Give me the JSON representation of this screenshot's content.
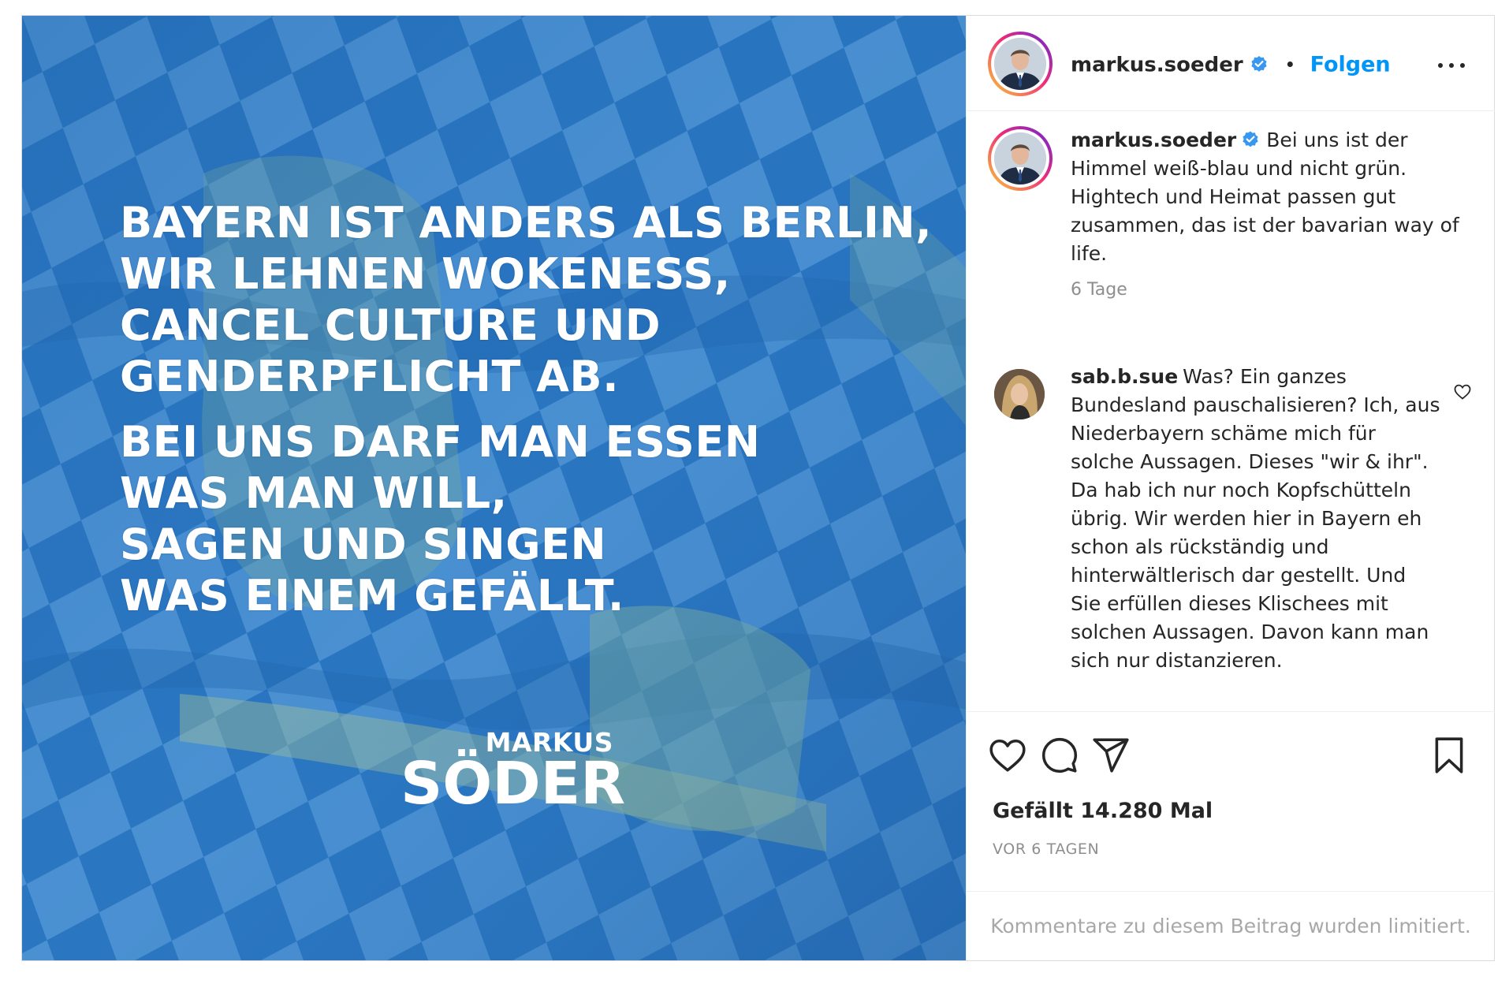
{
  "post": {
    "image": {
      "overlay_paragraphs": [
        [
          "BAYERN IST ANDERS ALS BERLIN,",
          "WIR LEHNEN WOKENESS,",
          "CANCEL CULTURE UND",
          "GENDERPFLICHT AB."
        ],
        [
          "BEI UNS DARF MAN ESSEN",
          "WAS MAN WILL,",
          "SAGEN UND SINGEN",
          "WAS EINEM GEFÄLLT."
        ]
      ],
      "signature_first": "MARKUS",
      "signature_last": "SÖDER"
    },
    "header": {
      "username": "markus.soeder",
      "separator": "•",
      "follow_label": "Folgen",
      "more_icon": "more-horizontal-icon"
    },
    "caption": {
      "username": "markus.soeder",
      "text": "Bei uns ist der Himmel weiß-blau und nicht grün. Hightech und Heimat passen gut zusammen, das ist der bavarian way of life.",
      "time": "6 Tage"
    },
    "comment": {
      "username": "sab.b.sue",
      "text": "Was? Ein ganzes Bundesland pauschalisieren? Ich, aus Niederbayern schäme mich für solche Aussagen. Dieses \"wir & ihr\". Da hab ich nur noch Kopfschütteln übrig. Wir werden hier in Bayern eh schon als rückständig und hinterwältlerisch dar gestellt. Und Sie erfüllen dieses Klischees mit solchen Aussagen. Davon kann man sich nur distanzieren."
    },
    "actions": {
      "icons": [
        "heart-icon",
        "comment-icon",
        "share-icon",
        "bookmark-icon"
      ],
      "likes_text": "Gefällt 14.280 Mal",
      "date_text": "VOR 6 TAGEN"
    },
    "comments_limited": "Kommentare zu diesem Beitrag wurden limitiert."
  },
  "colors": {
    "follow_blue": "#0095f6",
    "verified_blue": "#3897f0",
    "flag_blue": "#2f7cc6",
    "muted_text": "#8e8e8e"
  }
}
